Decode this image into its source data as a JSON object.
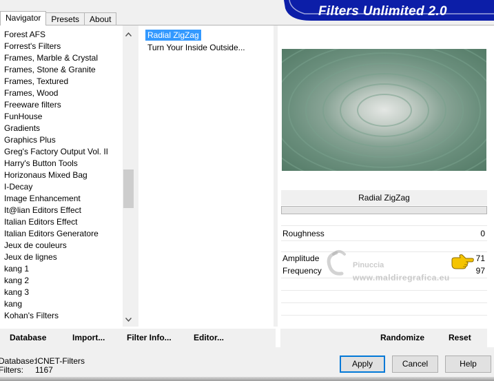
{
  "tabs": [
    {
      "label": "Navigator",
      "active": true
    },
    {
      "label": "Presets",
      "active": false
    },
    {
      "label": "About",
      "active": false
    }
  ],
  "banner": {
    "title": "Filters Unlimited 2.0",
    "color": "#0c1ea8"
  },
  "categories": [
    "Forest AFS",
    "Forrest's Filters",
    "Frames, Marble & Crystal",
    "Frames, Stone & Granite",
    "Frames, Textured",
    "Frames, Wood",
    "Freeware filters",
    "FunHouse",
    "Gradients",
    "Graphics Plus",
    "Greg's Factory Output Vol. II",
    "Harry's Button Tools",
    "Horizonaus Mixed Bag",
    "I-Decay",
    "Image Enhancement",
    "It@lian Editors Effect",
    "Italian Editors Effect",
    "Italian Editors Generatore",
    "Jeux de couleurs",
    "Jeux de lignes",
    "kang 1",
    "kang 2",
    "kang 3",
    "kang",
    "Kohan's Filters"
  ],
  "filters": [
    {
      "label": "Radial ZigZag",
      "selected": true
    },
    {
      "label": "Turn Your Inside Outside...",
      "selected": false
    }
  ],
  "filter_name": "Radial ZigZag",
  "params": [
    {
      "label": "Roughness",
      "value": "0"
    },
    {
      "label": "Amplitude",
      "value": "71"
    },
    {
      "label": "Frequency",
      "value": "97"
    }
  ],
  "watermark": {
    "line1": "Pinuccia",
    "line2": "www.maldiregrafica.eu"
  },
  "left_buttons": {
    "database": "Database",
    "import": "Import...",
    "filter_info": "Filter Info...",
    "editor": "Editor..."
  },
  "right_buttons": {
    "randomize": "Randomize",
    "reset": "Reset"
  },
  "footer": {
    "database_label": "Database:",
    "database_value": "ICNET-Filters",
    "filters_label": "Filters:",
    "filters_value": "1167"
  },
  "dialog_buttons": {
    "apply": "Apply",
    "cancel": "Cancel",
    "help": "Help"
  },
  "colors": {
    "selection": "#3399ff",
    "accent_border": "#0078d7"
  }
}
